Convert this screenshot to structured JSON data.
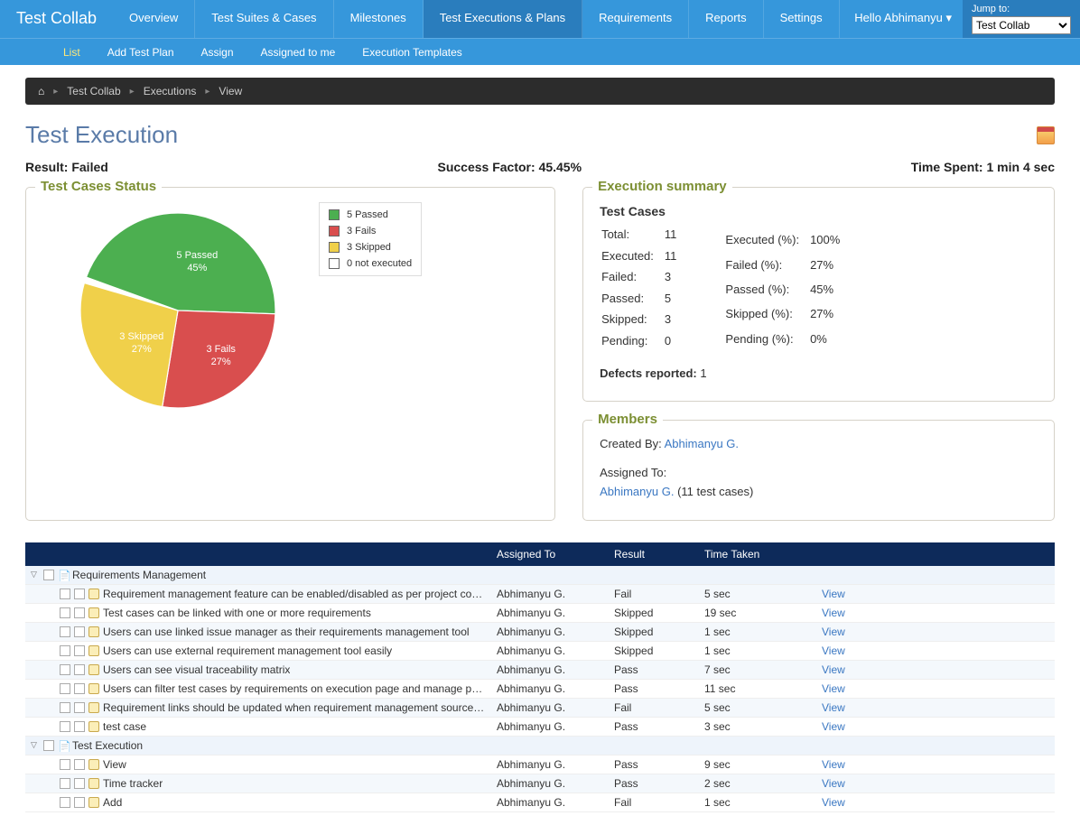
{
  "brand": "Test Collab",
  "nav": {
    "items": [
      "Overview",
      "Test Suites & Cases",
      "Milestones",
      "Test Executions & Plans",
      "Requirements",
      "Reports",
      "Settings"
    ],
    "active": 3,
    "hello": "Hello Abhimanyu ▾",
    "jump_label": "Jump to:",
    "jump_options": [
      "Test Collab"
    ]
  },
  "subnav": {
    "items": [
      "List",
      "Add Test Plan",
      "Assign",
      "Assigned to me",
      "Execution Templates"
    ],
    "active": 0
  },
  "breadcrumb": [
    "Test Collab",
    "Executions",
    "View"
  ],
  "page_title": "Test Execution",
  "stats": {
    "result_label": "Result:",
    "result_value": "Failed",
    "success_label": "Success Factor:",
    "success_value": "45.45%",
    "time_label": "Time Spent:",
    "time_value": "1 min 4 sec"
  },
  "tcstatus_title": "Test Cases Status",
  "legend": {
    "pass": "5 Passed",
    "fail": "3 Fails",
    "skip": "3 Skipped",
    "noexec": "0 not executed"
  },
  "chart_data": {
    "type": "pie",
    "title": "Test Cases Status",
    "slices": [
      {
        "label": "5 Passed",
        "percent": 45,
        "color": "#4caf50"
      },
      {
        "label": "3 Fails",
        "percent": 27,
        "color": "#d94e4e"
      },
      {
        "label": "3 Skipped",
        "percent": 27,
        "color": "#f0d04a"
      },
      {
        "label": "0 not executed",
        "percent": 0,
        "color": "#ffffff"
      }
    ]
  },
  "summary": {
    "title": "Execution summary",
    "heading": "Test Cases",
    "rows": [
      {
        "label": "Total:",
        "value": "11",
        "pct_label": "",
        "pct_value": ""
      },
      {
        "label": "Executed:",
        "value": "11",
        "pct_label": "Executed (%):",
        "pct_value": "100%"
      },
      {
        "label": "Failed:",
        "value": "3",
        "pct_label": "Failed (%):",
        "pct_value": "27%"
      },
      {
        "label": "Passed:",
        "value": "5",
        "pct_label": "Passed (%):",
        "pct_value": "45%"
      },
      {
        "label": "Skipped:",
        "value": "3",
        "pct_label": "Skipped (%):",
        "pct_value": "27%"
      },
      {
        "label": "Pending:",
        "value": "0",
        "pct_label": "Pending (%):",
        "pct_value": "0%"
      }
    ],
    "defects_label": "Defects reported:",
    "defects_value": "1"
  },
  "members": {
    "title": "Members",
    "created_label": "Created By:",
    "created_by": "Abhimanyu G.",
    "assigned_label": "Assigned To:",
    "assigned_to": "Abhimanyu G.",
    "assigned_suffix": "(11 test cases)"
  },
  "table": {
    "headers": [
      "",
      "Assigned To",
      "Result",
      "Time Taken",
      ""
    ],
    "groups": [
      {
        "name": "Requirements Management",
        "rows": [
          {
            "name": "Requirement management feature can be enabled/disabled as per project configura",
            "assigned": "Abhimanyu G.",
            "result": "Fail",
            "time": "5 sec",
            "action": "View"
          },
          {
            "name": "Test cases can be linked with one or more requirements",
            "assigned": "Abhimanyu G.",
            "result": "Skipped",
            "time": "19 sec",
            "action": "View"
          },
          {
            "name": "Users can use linked issue manager as their requirements management tool",
            "assigned": "Abhimanyu G.",
            "result": "Skipped",
            "time": "1 sec",
            "action": "View"
          },
          {
            "name": "Users can use external requirement management tool easily",
            "assigned": "Abhimanyu G.",
            "result": "Skipped",
            "time": "1 sec",
            "action": "View"
          },
          {
            "name": "Users can see visual traceability matrix",
            "assigned": "Abhimanyu G.",
            "result": "Pass",
            "time": "7 sec",
            "action": "View"
          },
          {
            "name": "Users can filter test cases by requirements on execution page and manage page",
            "assigned": "Abhimanyu G.",
            "result": "Pass",
            "time": "11 sec",
            "action": "View"
          },
          {
            "name": "Requirement links should be updated when requirement management source settin",
            "assigned": "Abhimanyu G.",
            "result": "Fail",
            "time": "5 sec",
            "action": "View"
          },
          {
            "name": "test case",
            "assigned": "Abhimanyu G.",
            "result": "Pass",
            "time": "3 sec",
            "action": "View"
          }
        ]
      },
      {
        "name": "Test Execution",
        "rows": [
          {
            "name": "View",
            "assigned": "Abhimanyu G.",
            "result": "Pass",
            "time": "9 sec",
            "action": "View"
          },
          {
            "name": "Time tracker",
            "assigned": "Abhimanyu G.",
            "result": "Pass",
            "time": "2 sec",
            "action": "View"
          },
          {
            "name": "Add",
            "assigned": "Abhimanyu G.",
            "result": "Fail",
            "time": "1 sec",
            "action": "View"
          }
        ]
      }
    ]
  }
}
